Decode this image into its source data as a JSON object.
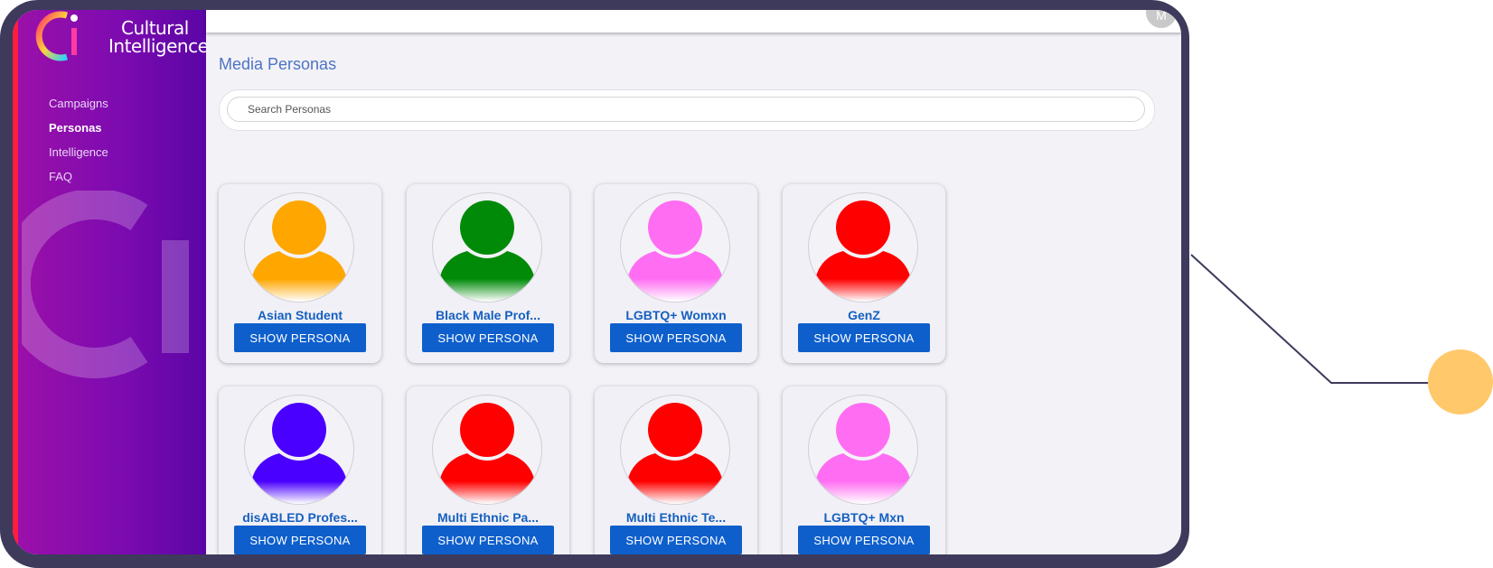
{
  "brand": {
    "line1": "Cultural",
    "line2": "Intelligence"
  },
  "nav": [
    "Campaigns",
    "Personas",
    "Intelligence",
    "FAQ"
  ],
  "user": {
    "initial": "M"
  },
  "page": {
    "title": "Media Personas"
  },
  "search": {
    "placeholder": "Search Personas"
  },
  "button_label": "SHOW PERSONA",
  "personas": [
    {
      "name": "Asian Student",
      "color": "#ffa600"
    },
    {
      "name": "Black Male Prof...",
      "color": "#008a08"
    },
    {
      "name": "LGBTQ+ Womxn",
      "color": "#ff6ef2"
    },
    {
      "name": "GenZ",
      "color": "#ff0000"
    },
    {
      "name": "disABLED Profes...",
      "color": "#4a00ff"
    },
    {
      "name": "Multi Ethnic Pa...",
      "color": "#ff0000"
    },
    {
      "name": "Multi Ethnic Te...",
      "color": "#ff0000"
    },
    {
      "name": "LGBTQ+ Mxn",
      "color": "#ff6ef2"
    }
  ],
  "colors": {
    "sidebar": "#7d0bb0",
    "accent_red": "#ff1e3d",
    "button": "#0e5fcc",
    "title": "#4e74c4",
    "frame": "#3d3a5c",
    "dot": "#ffc86b"
  }
}
